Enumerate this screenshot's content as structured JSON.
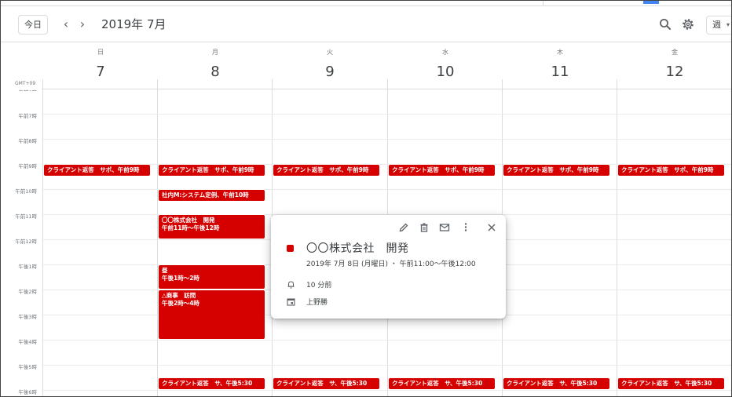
{
  "header": {
    "today_label": "今日",
    "prev_label": "‹",
    "next_label": "›",
    "title": "2019年 7月",
    "view_label": "週",
    "view_caret": "▾",
    "icons": [
      "search-icon",
      "gear-icon"
    ]
  },
  "timezone": "GMT+09",
  "days": [
    {
      "dow": "日",
      "num": "7"
    },
    {
      "dow": "月",
      "num": "8"
    },
    {
      "dow": "火",
      "num": "9"
    },
    {
      "dow": "水",
      "num": "10"
    },
    {
      "dow": "木",
      "num": "11"
    },
    {
      "dow": "金",
      "num": "12"
    }
  ],
  "hours": [
    "午前6時",
    "午前7時",
    "午前8時",
    "午前9時",
    "午前10時",
    "午前11時",
    "午前12時",
    "午後1時",
    "午後2時",
    "午後3時",
    "午後4時",
    "午後5時",
    "午後6時"
  ],
  "events": {
    "morning": "クライアント返答　サポ、午前9時",
    "evening": "クライアント返答　サ、午後5:30",
    "meeting": "社内M:システム定例、午前10時",
    "dev_title": "〇〇株式会社　開発",
    "dev_time": "午前11時～午後12時",
    "lunch_title": "昼",
    "lunch_time": "午後1時～2時",
    "visit_title": "△商事　訪問",
    "visit_time": "午後2時～4時"
  },
  "popup": {
    "title": "〇〇株式会社　開発",
    "date": "2019年 7月 8日 (月曜日) ・ 午前11:00～午後12:00",
    "reminder": "10 分前",
    "calendar": "上野勝",
    "color": "#d50000",
    "icons": [
      "edit-icon",
      "delete-icon",
      "email-icon",
      "more-icon",
      "close-icon",
      "bell-icon",
      "calendar-icon"
    ]
  },
  "colors": {
    "event": "#d50000",
    "border": "#dadce0",
    "text": "#3c4043"
  }
}
